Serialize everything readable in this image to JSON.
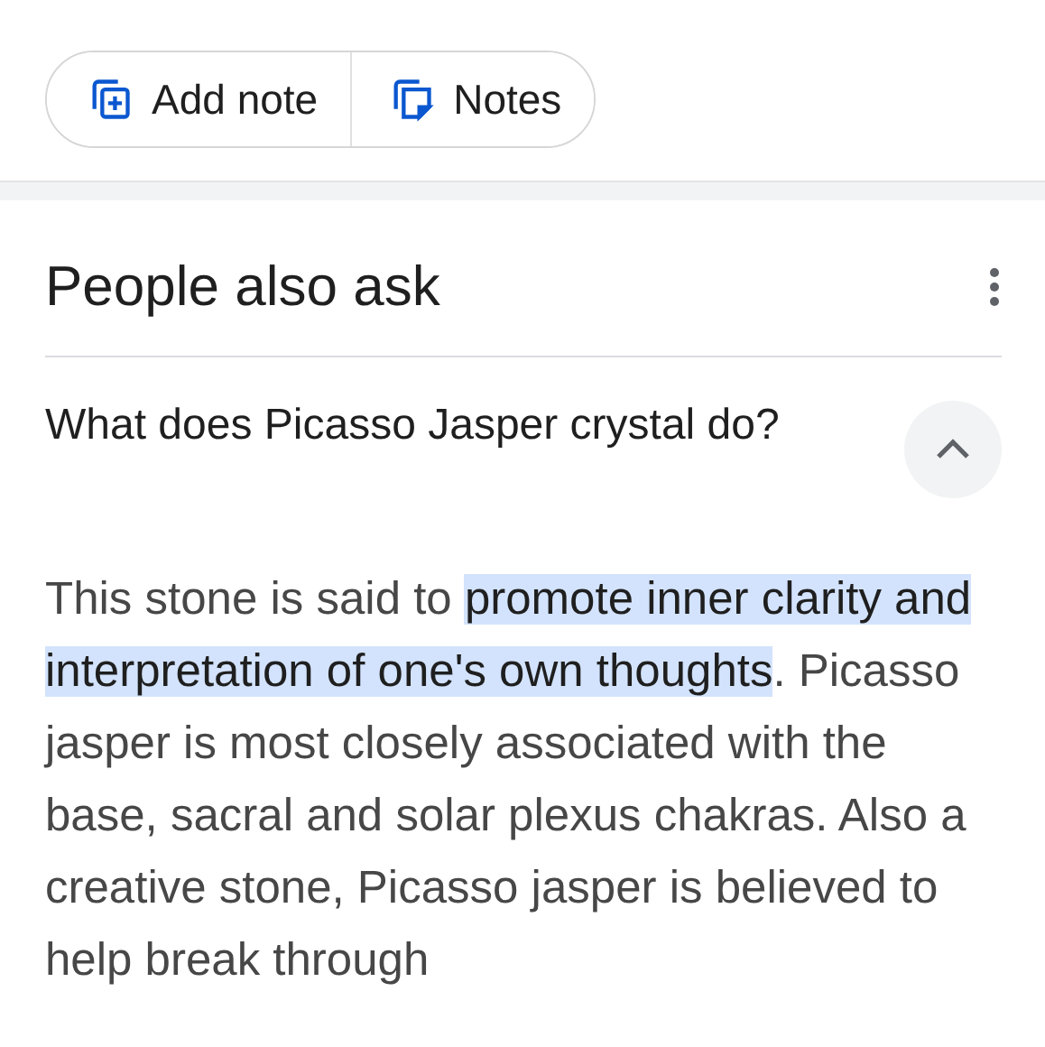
{
  "note_buttons": [
    {
      "kind": "add",
      "label": "Add note"
    },
    {
      "kind": "notes",
      "label": "Notes"
    }
  ],
  "people_also_ask": {
    "title": "People also ask",
    "questions": [
      {
        "question": "What does Picasso Jasper crystal do?",
        "expanded": true,
        "answer": {
          "before": "This stone is said to ",
          "highlighted": "promote inner clarity and interpretation of one's own thoughts",
          "after": ". Picasso jasper is most closely associated with the base, sacral and solar plexus chakras. Also a creative stone, Picasso jasper is believed to help break through"
        }
      }
    ]
  }
}
